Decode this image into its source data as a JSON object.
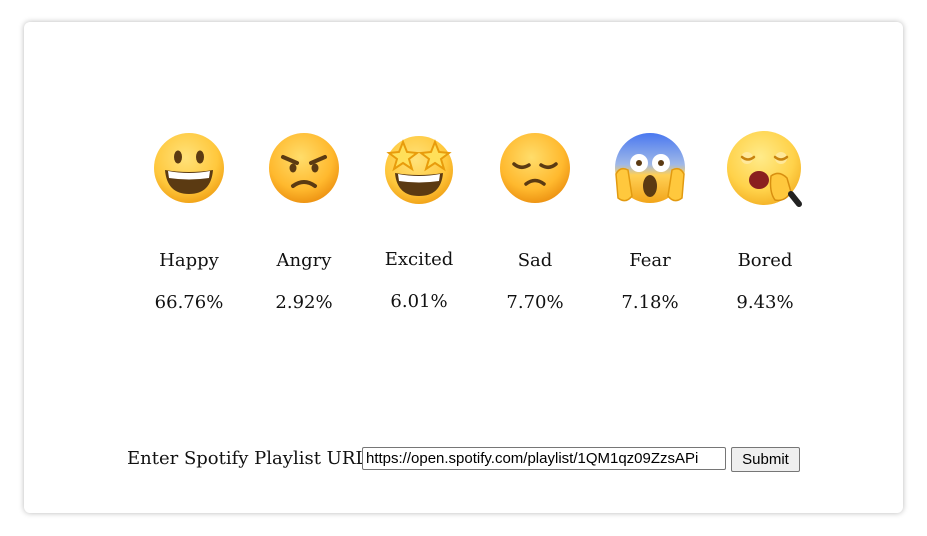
{
  "emotions": [
    {
      "icon": "grinning-face-icon",
      "label": "Happy",
      "percent": "66.76%"
    },
    {
      "icon": "angry-face-icon",
      "label": "Angry",
      "percent": "2.92%"
    },
    {
      "icon": "star-struck-face-icon",
      "label": "Excited",
      "percent": "6.01%"
    },
    {
      "icon": "disappointed-face-icon",
      "label": "Sad",
      "percent": "7.70%"
    },
    {
      "icon": "screaming-in-fear-face-icon",
      "label": "Fear",
      "percent": "7.18%"
    },
    {
      "icon": "yawning-face-icon",
      "label": "Bored",
      "percent": "9.43%"
    }
  ],
  "form": {
    "label": "Enter Spotify Playlist URL:",
    "url_value": "https://open.spotify.com/playlist/1QM1qz09ZzsAPi",
    "submit_label": "Submit"
  },
  "colors": {
    "emoji_yellow": "#FFC83D",
    "emoji_outline": "#E29A10"
  }
}
